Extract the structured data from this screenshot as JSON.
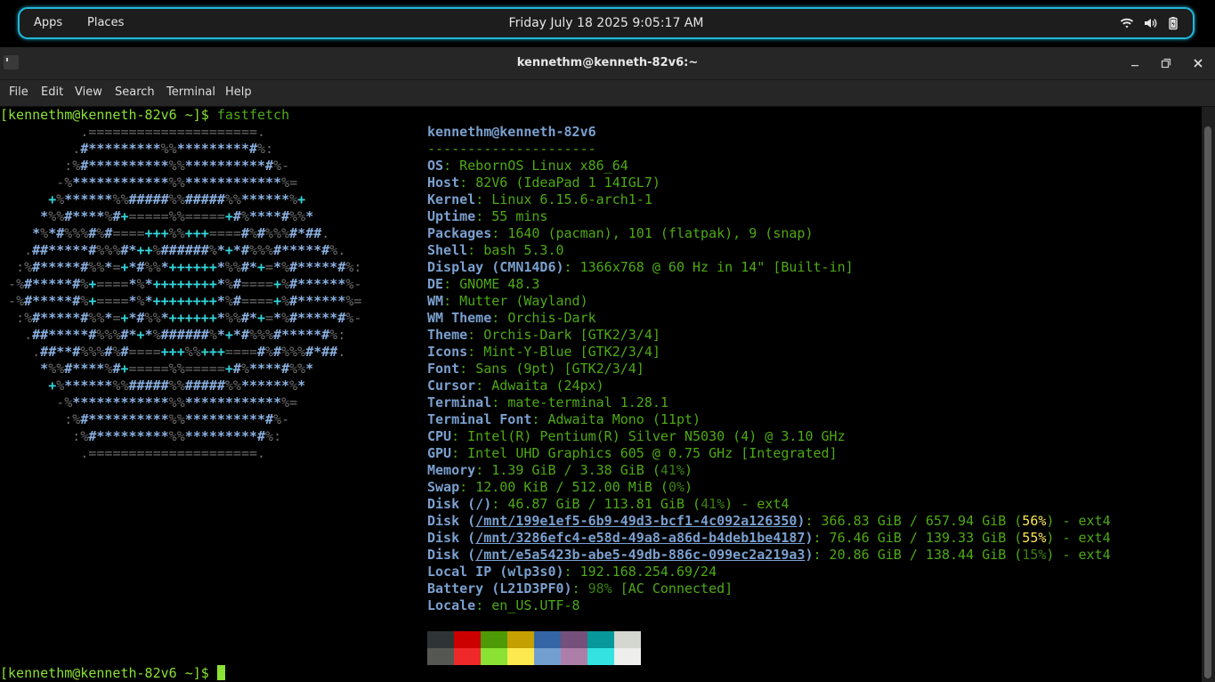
{
  "topbar": {
    "apps": "Apps",
    "places": "Places",
    "clock": "Friday July 18 2025 9:05:17 AM",
    "icons": [
      "wifi-icon",
      "volume-icon",
      "battery-icon"
    ]
  },
  "window": {
    "title": "kennethm@kenneth-82v6:~",
    "controls": [
      "minimize-icon",
      "maximize-icon",
      "close-icon"
    ]
  },
  "menu": [
    "File",
    "Edit",
    "View",
    "Search",
    "Terminal",
    "Help"
  ],
  "terminal": {
    "prompt": "[kennethm@kenneth-82v6 ~]$ ",
    "command": "fastfetch",
    "ascii_art": [
      "          .=====================.",
      "         .#*********%%*********#%:",
      "        :%#**********%%**********#%-",
      "       -%************%%************%=",
      "      +%******%%#####%%#####%%******%+",
      "     *%%#****%#+=====%%=====+#%****#%%*",
      "    *%*#%%%#%#====+++%%+++====#%#%%%#*##.",
      "   .##*****#%%%#*++%######%*+*#%%%#*****#%.",
      "  :%#*****#%%*=+*#%%*++++++*%%#*+=*%#*****#%:",
      " -%#*****#%+====*%*++++++++*%#====+%#******%-",
      " -%#*****#%+====*%*++++++++*%#====+%#******%=",
      "  :%#*****#%%*=+*#%%*++++++*%%#*+=*%#*****#%-",
      "   .##*****#%%%#*+*%######%*+*#%%%#*****#%:",
      "    .##**#%%%#%#====+++%%+++====#%#%%%#*##.",
      "     *%%#****%#+=====%%=====+#%****#%%*",
      "      +%******%%#####%%#####%%******%*",
      "       -%************%%************%=",
      "        :%#**********%%**********#%-",
      "         :%#*********%%*********#%:",
      "          .=====================."
    ],
    "user_host": "kennethm@kenneth-82v6",
    "separator": "---------------------",
    "info": [
      {
        "key": "OS",
        "value": "RebornOS Linux x86_64"
      },
      {
        "key": "Host",
        "value": "82V6 (IdeaPad 1 14IGL7)"
      },
      {
        "key": "Kernel",
        "value": "Linux 6.15.6-arch1-1"
      },
      {
        "key": "Uptime",
        "value": "55 mins"
      },
      {
        "key": "Packages",
        "value": "1640 (pacman), 101 (flatpak), 9 (snap)"
      },
      {
        "key": "Shell",
        "value": "bash 5.3.0"
      },
      {
        "key": "Display (CMN14D6)",
        "value": "1366x768 @ 60 Hz in 14\" [Built-in]"
      },
      {
        "key": "DE",
        "value": "GNOME 48.3"
      },
      {
        "key": "WM",
        "value": "Mutter (Wayland)"
      },
      {
        "key": "WM Theme",
        "value": "Orchis-Dark"
      },
      {
        "key": "Theme",
        "value": "Orchis-Dark [GTK2/3/4]"
      },
      {
        "key": "Icons",
        "value": "Mint-Y-Blue [GTK2/3/4]"
      },
      {
        "key": "Font",
        "value": "Sans (9pt) [GTK2/3/4]"
      },
      {
        "key": "Cursor",
        "value": "Adwaita (24px)"
      },
      {
        "key": "Terminal",
        "value": "mate-terminal 1.28.1"
      },
      {
        "key": "Terminal Font",
        "value": "Adwaita Mono (11pt)"
      },
      {
        "key": "CPU",
        "value": "Intel(R) Pentium(R) Silver N5030 (4) @ 3.10 GHz"
      },
      {
        "key": "GPU",
        "value": "Intel UHD Graphics 605 @ 0.75 GHz [Integrated]"
      }
    ],
    "memory": {
      "key": "Memory",
      "value": "1.39 GiB / 3.38 GiB (",
      "pct": "41%",
      "suffix": ")"
    },
    "swap": {
      "key": "Swap",
      "value": "12.00 KiB / 512.00 MiB (",
      "pct": "0%",
      "suffix": ")"
    },
    "disks": [
      {
        "key_pre": "Disk (",
        "path": "/",
        "key_post": ")",
        "value": "46.87 GiB / 113.81 GiB (",
        "pct": "41%",
        "suffix": ") - ext4",
        "pct_color": "green"
      },
      {
        "key_pre": "Disk (",
        "path": "/mnt/199e1ef5-6b9-49d3-bcf1-4c092a126350",
        "key_post": ")",
        "value": "366.83 GiB / 657.94 GiB (",
        "pct": "56%",
        "suffix": ") - ext4",
        "pct_color": "yellow"
      },
      {
        "key_pre": "Disk (",
        "path": "/mnt/3286efc4-e58d-49a8-a86d-b4deb1be4187",
        "key_post": ")",
        "value": "76.46 GiB / 139.33 GiB (",
        "pct": "55%",
        "suffix": ") - ext4",
        "pct_color": "yellow"
      },
      {
        "key_pre": "Disk (",
        "path": "/mnt/e5a5423b-abe5-49db-886c-099ec2a219a3",
        "key_post": ")",
        "value": "20.86 GiB / 138.44 GiB (",
        "pct": "15%",
        "suffix": ") - ext4",
        "pct_color": "green"
      }
    ],
    "local_ip": {
      "key": "Local IP (wlp3s0)",
      "value": "192.168.254.69/24"
    },
    "battery": {
      "key": "Battery (L21D3PF0)",
      "pct": "98%",
      "value": " [AC Connected]"
    },
    "locale": {
      "key": "Locale",
      "value": "en_US.UTF-8"
    },
    "palette": [
      "#2e3436",
      "#cc0000",
      "#4e9a06",
      "#c4a000",
      "#3465a4",
      "#75507b",
      "#06989a",
      "#d3d7cf",
      "#555753",
      "#ef2929",
      "#8ae234",
      "#fce94f",
      "#729fcf",
      "#ad7fa8",
      "#34e2e2",
      "#eeeeec"
    ]
  }
}
